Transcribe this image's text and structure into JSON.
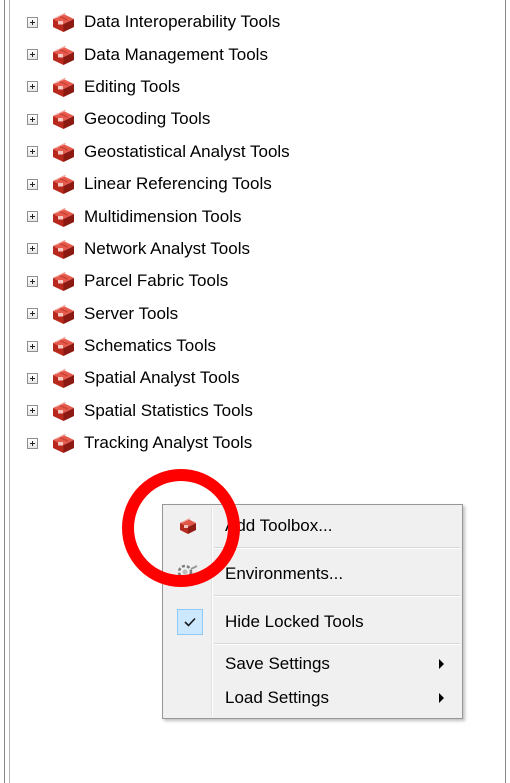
{
  "tree": {
    "items": [
      {
        "label": "Data Interoperability Tools"
      },
      {
        "label": "Data Management Tools"
      },
      {
        "label": "Editing Tools"
      },
      {
        "label": "Geocoding Tools"
      },
      {
        "label": "Geostatistical Analyst Tools"
      },
      {
        "label": "Linear Referencing Tools"
      },
      {
        "label": "Multidimension Tools"
      },
      {
        "label": "Network Analyst Tools"
      },
      {
        "label": "Parcel Fabric Tools"
      },
      {
        "label": "Server Tools"
      },
      {
        "label": "Schematics Tools"
      },
      {
        "label": "Spatial Analyst Tools"
      },
      {
        "label": "Spatial Statistics Tools"
      },
      {
        "label": "Tracking Analyst Tools"
      }
    ],
    "icon": "toolbox-icon",
    "expander_icon": "plus-expander-icon"
  },
  "context_menu": {
    "add_toolbox": "Add Toolbox...",
    "environments": "Environments...",
    "hide_locked_tools": "Hide Locked Tools",
    "hide_locked_tools_checked": true,
    "save_settings": "Save Settings",
    "load_settings": "Load Settings"
  },
  "annotation": {
    "highlight_color": "#ff0000",
    "shape": "circle"
  },
  "colors": {
    "toolbox_red": "#d23a2a",
    "menu_background": "#f0f0f0",
    "check_highlight": "#cce8ff"
  }
}
